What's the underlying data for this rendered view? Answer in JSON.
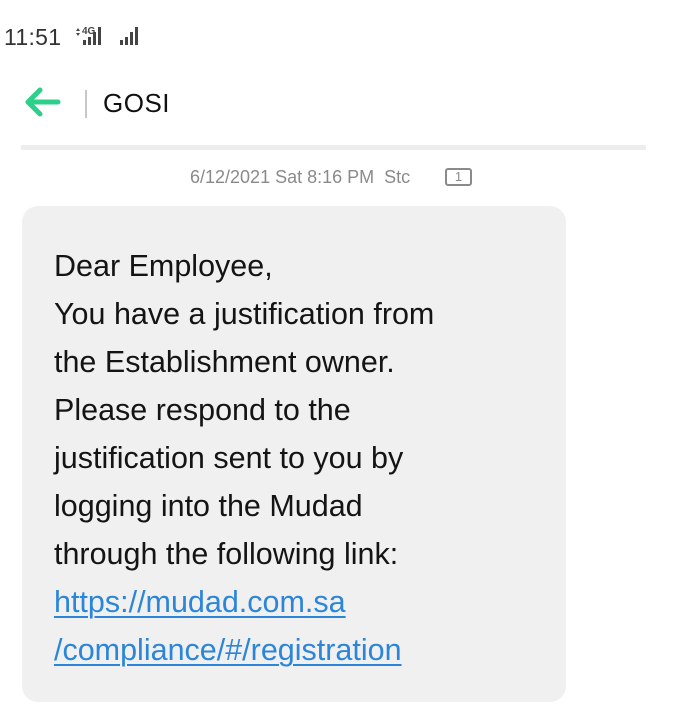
{
  "status_bar": {
    "time": "11:51",
    "network_label": "4G"
  },
  "header": {
    "title": "GOSI"
  },
  "message": {
    "date": "6/12/2021 Sat 8:16 PM",
    "carrier": "Stc",
    "sim": "1",
    "lines": [
      "Dear Employee,",
      "You have a justification from",
      "the Establishment owner.",
      "Please respond to the",
      "justification sent to you by",
      "logging into the Mudad",
      "through the following link:"
    ],
    "link_lines": [
      "https://mudad.com.sa",
      "/compliance/#/registration"
    ]
  },
  "colors": {
    "accent": "#2ecf8a",
    "link": "#2b86d9",
    "bubble": "#f0f0f0"
  }
}
